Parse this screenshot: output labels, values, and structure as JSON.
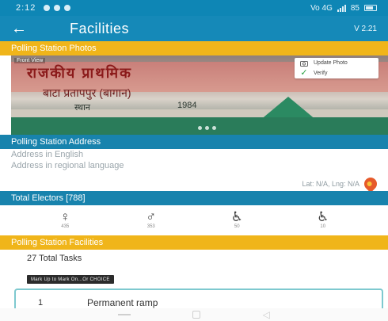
{
  "status_bar": {
    "time": "2:12",
    "network": "Vo 4G",
    "battery": "85"
  },
  "app_bar": {
    "back_icon": "arrow-left-icon",
    "title": "Facilities",
    "version": "V 2.21"
  },
  "sections": {
    "photos": "Polling Station Photos",
    "address": "Polling Station Address",
    "electors": "Total Electors [788]",
    "facilities": "Polling Station Facilities"
  },
  "photo": {
    "tag": "Front View",
    "sign_line1": "राजकीय प्राथमिक",
    "sign_line2": "बाटा प्रतापपुर (बागान)",
    "sign_line3": "स्थान",
    "sign_num": "1984",
    "update_photo_label": "Update Photo",
    "verify_label": "Verify"
  },
  "address": {
    "english": "Address in English",
    "regional": "Address in regional language",
    "latlng": "Lat: N/A, Lng: N/A"
  },
  "electors": {
    "items": [
      {
        "icon": "female-voter-icon",
        "caption": "435"
      },
      {
        "icon": "male-voter-icon",
        "caption": "353"
      },
      {
        "icon": "senior-citizen-icon",
        "caption": "50"
      },
      {
        "icon": "wheelchair-icon",
        "caption": "10"
      }
    ]
  },
  "facilities": {
    "tasks_count": "27 Total Tasks",
    "mark_button": "Mark Up to Mark On...Or CHOICE",
    "first_task": {
      "num": "1",
      "name": "Permanent ramp"
    }
  },
  "colors": {
    "primary_blue": "#1589b8",
    "accent_yellow": "#f0b51a",
    "pin_orange": "#e65a2a"
  }
}
